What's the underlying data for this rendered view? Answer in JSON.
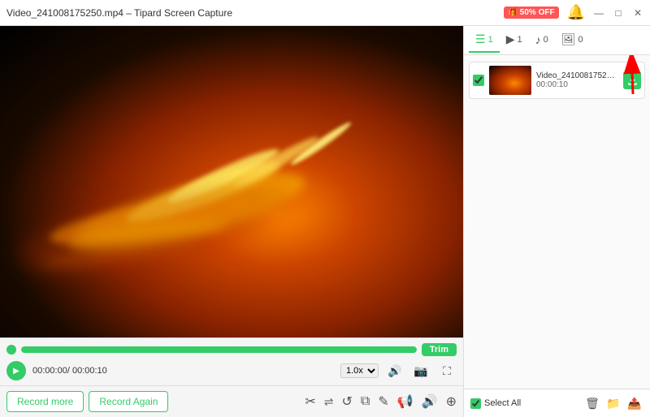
{
  "titlebar": {
    "title": "Video_241008175250.mp4  –  Tipard Screen Capture",
    "promo_label": "50% OFF",
    "btn_minimize": "—",
    "btn_maximize": "□",
    "btn_close": "✕"
  },
  "tabs": [
    {
      "icon": "☰",
      "count": "1",
      "label": "video"
    },
    {
      "icon": "▶",
      "count": "1",
      "label": "video2"
    },
    {
      "icon": "♪",
      "count": "0",
      "label": "audio"
    },
    {
      "icon": "🖼",
      "count": "0",
      "label": "image"
    }
  ],
  "file_item": {
    "name": "Video_241008175250.mp4",
    "duration": "00:00:10",
    "checkbox_checked": true
  },
  "controls": {
    "trim_label": "Trim",
    "time_current": "00:00:00",
    "time_total": "00:00:10",
    "time_separator": "/",
    "speed_value": "1.0x",
    "progress_percent": 100
  },
  "buttons": {
    "record_more": "Record more",
    "record_again": "Record Again",
    "select_all": "Select All"
  },
  "action_icons": [
    "✂",
    "☰",
    "↺",
    "⧉",
    "✎",
    "📢",
    "🔊",
    "⊕"
  ],
  "right_toolbar_icons": [
    "🗑",
    "📁",
    "📤"
  ]
}
